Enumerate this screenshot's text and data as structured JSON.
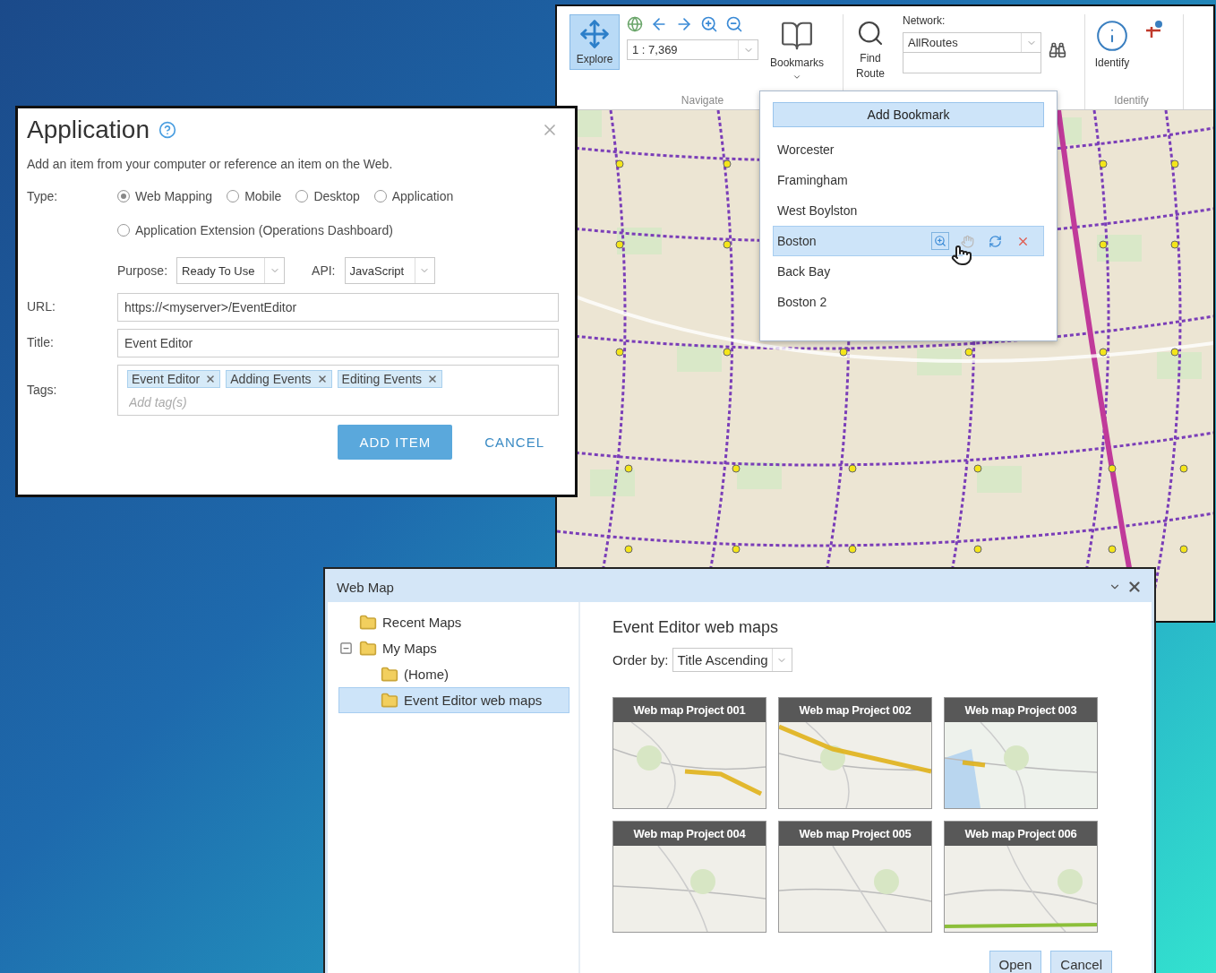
{
  "map_window": {
    "ribbon": {
      "explore": {
        "label": "Explore",
        "selected": true
      },
      "scale": "1 : 7,369",
      "bookmarks": "Bookmarks",
      "navigate_group": "Navigate",
      "find_route": "Find Route",
      "network": {
        "label": "Network:",
        "value": "AllRoutes"
      },
      "identify": "Identify",
      "identify_group": "Identify"
    },
    "bookmarks_menu": {
      "add_button": "Add Bookmark",
      "items": [
        {
          "label": "Worcester",
          "selected": false
        },
        {
          "label": "Framingham",
          "selected": false
        },
        {
          "label": "West Boylston",
          "selected": false
        },
        {
          "label": "Boston",
          "selected": true
        },
        {
          "label": "Back Bay",
          "selected": false
        },
        {
          "label": "Boston 2",
          "selected": false
        }
      ]
    }
  },
  "application_dialog": {
    "title": "Application",
    "description": "Add an item from your computer or reference an item on the Web.",
    "type_label": "Type:",
    "type_options": [
      {
        "label": "Web Mapping",
        "selected": true
      },
      {
        "label": "Mobile",
        "selected": false
      },
      {
        "label": "Desktop",
        "selected": false
      },
      {
        "label": "Application",
        "selected": false
      },
      {
        "label": "Application Extension (Operations Dashboard)",
        "selected": false
      }
    ],
    "purpose_label": "Purpose:",
    "purpose": "Ready To Use",
    "api_label": "API:",
    "api": "JavaScript",
    "url_label": "URL:",
    "url": "https://<myserver>/EventEditor",
    "title_label": "Title:",
    "title_value": "Event Editor",
    "tags_label": "Tags:",
    "tags": [
      "Event Editor",
      "Adding Events",
      "Editing Events"
    ],
    "tags_placeholder": "Add tag(s)",
    "add_button": "ADD ITEM",
    "cancel_button": "CANCEL"
  },
  "web_map_dialog": {
    "title": "Web Map",
    "tree": [
      {
        "label": "Recent Maps",
        "selected": false
      },
      {
        "label": "My Maps",
        "selected": false,
        "expanded": true,
        "children": [
          {
            "label": "(Home)",
            "selected": false
          },
          {
            "label": "Event Editor web maps",
            "selected": true
          }
        ]
      }
    ],
    "heading": "Event Editor web maps",
    "order_label": "Order by:",
    "order_value": "Title Ascending",
    "maps": [
      "Web map Project 001",
      "Web map Project 002",
      "Web map Project 003",
      "Web map Project 004",
      "Web map Project 005",
      "Web map Project 006"
    ],
    "open_button": "Open",
    "cancel_button": "Cancel"
  }
}
